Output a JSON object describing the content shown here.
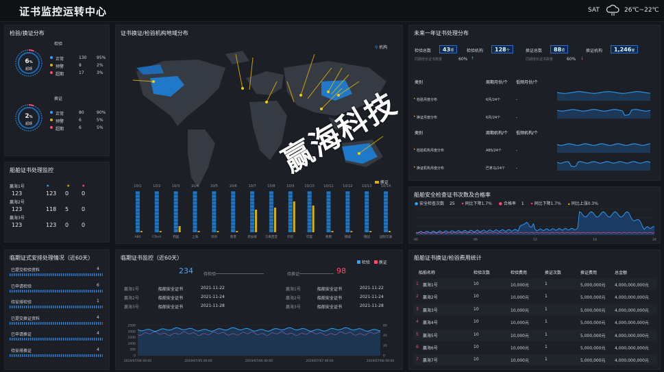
{
  "header": {
    "title": "证书监控运转中心",
    "day": "SAT",
    "temp": "26℃~22℃"
  },
  "insp": {
    "title": "检验/换证分布",
    "g1": {
      "label": "检验",
      "pct": "6",
      "unit": "%",
      "sub": "超期",
      "rows": [
        {
          "n": "正常",
          "c": "130",
          "p": "95%",
          "col": "#2aa4ff"
        },
        {
          "n": "预警",
          "c": "8",
          "p": "2%",
          "col": "#e0b000"
        },
        {
          "n": "超期",
          "c": "17",
          "p": "3%",
          "col": "#ff4d6d"
        }
      ]
    },
    "g2": {
      "label": "换证",
      "pct": "2",
      "unit": "%",
      "sub": "超期",
      "rows": [
        {
          "n": "正常",
          "c": "80",
          "p": "90%",
          "col": "#2aa4ff"
        },
        {
          "n": "预警",
          "c": "6",
          "p": "5%",
          "col": "#e0b000"
        },
        {
          "n": "超期",
          "c": "6",
          "p": "5%",
          "col": "#ff4d6d"
        }
      ]
    }
  },
  "ship": {
    "title": "船舶证书处理监控",
    "rows": [
      {
        "n": "赢海1号",
        "a": "123",
        "b": "123",
        "c": "0",
        "d": "0"
      },
      {
        "n": "赢海2号",
        "a": "123",
        "b": "118",
        "c": "5",
        "d": "0"
      },
      {
        "n": "赢海3号",
        "a": "123",
        "b": "123",
        "c": "0",
        "d": "0"
      }
    ]
  },
  "expire": {
    "title": "临期证式安排处理情况（近60天）",
    "rows": [
      {
        "n": "已提交检验资料",
        "v": "4"
      },
      {
        "n": "已申请检验",
        "v": "6"
      },
      {
        "n": "待安排检验",
        "v": "1"
      },
      {
        "n": "已提交换证资料",
        "v": "4"
      },
      {
        "n": "已申请换证",
        "v": "4"
      },
      {
        "n": "待安排换证",
        "v": "4"
      }
    ]
  },
  "map": {
    "title": "证书换证/检验机构地域分布",
    "legend": "机构",
    "legend2": "换证",
    "months": [
      "10/1",
      "10/2",
      "10/3",
      "10/4",
      "10/5",
      "10/6",
      "10/7",
      "10/8",
      "10/9",
      "10/10",
      "10/11",
      "10/12",
      "10/13",
      "10/14"
    ],
    "xlabels": [
      "ABS",
      "CTech",
      "韩国",
      "上海",
      "深圳",
      "香港",
      "新加坡",
      "马来西亚",
      "印尼",
      "印度",
      "希腊",
      "挪威",
      "德国",
      "国际交通"
    ],
    "chart_data": {
      "type": "bar",
      "categories": [
        "ABS",
        "CTech",
        "韩国",
        "上海",
        "深圳",
        "香港",
        "新加坡",
        "马来西亚",
        "印尼",
        "印度",
        "希腊",
        "挪威",
        "德国",
        "国际交通"
      ],
      "series": [
        {
          "values": [
            100,
            100,
            100,
            100,
            100,
            100,
            100,
            100,
            100,
            100,
            100,
            100,
            100,
            100
          ]
        },
        {
          "name": "换证",
          "values": [
            3,
            3,
            15,
            3,
            3,
            3,
            55,
            60,
            75,
            65,
            3,
            3,
            3,
            3
          ]
        }
      ],
      "ylim": [
        0,
        100
      ]
    }
  },
  "year": {
    "title": "未来一年证书处理分布",
    "kpis": [
      {
        "n": "检验总数",
        "v": "43",
        "u": "项"
      },
      {
        "n": "检验机构",
        "v": "128",
        "u": "个"
      },
      {
        "n": "换证总数",
        "v": "88",
        "u": "项"
      },
      {
        "n": "换证机构",
        "v": "1,246",
        "u": "家"
      }
    ],
    "sub1": "同期增长证书数量",
    "sub1v": "60%",
    "sub2": "同期增长证书数量",
    "sub2v": "60%",
    "h1": [
      "类别",
      "周期月份/个",
      "低频月份/个"
    ],
    "r1": [
      {
        "n": "检验月度分布",
        "a": "6月/24个",
        "b": "-"
      },
      {
        "n": "换证月度分布",
        "a": "6月/24个",
        "b": "-"
      }
    ],
    "h2": [
      "类别",
      "周期机构/个",
      "低频机构/个"
    ],
    "r2": [
      {
        "n": "检验机构月度分布",
        "a": "ABS/24个",
        "b": "-"
      },
      {
        "n": "换证机构月度分布",
        "a": "巴拿马/24个",
        "b": "-"
      }
    ]
  },
  "rate": {
    "title": "船舶安全检查证书次数及合格率",
    "l1": "安全检查次数",
    "l1v": "25",
    "l2": "同比下降1.7%",
    "l3": "合格率",
    "l3v": "1",
    "l4": "同比下降1.7%",
    "l5": "同比上涨0.3%",
    "xt": [
      "00",
      "06",
      "12",
      "18",
      "24"
    ]
  },
  "mon": {
    "title": "临期证书监控（近60天）",
    "lg1": "检验",
    "lg2": "换证",
    "left": {
      "label": "待检验",
      "v": "234"
    },
    "right": {
      "label": "待换证",
      "v": "98"
    },
    "rowsL": [
      {
        "a": "赢海1号",
        "b": "船舶安全证书",
        "c": "2021-11-22"
      },
      {
        "a": "赢海2号",
        "b": "船舶安全证书",
        "c": "2021-11-24"
      },
      {
        "a": "赢海3号",
        "b": "船舶安全证书",
        "c": "2021-11-28"
      }
    ],
    "rowsR": [
      {
        "a": "赢海1号",
        "b": "船舶安全证书",
        "c": "2021-11-22"
      },
      {
        "a": "赢海2号",
        "b": "船舶安全证书",
        "c": "2021-11-24"
      },
      {
        "a": "赢海3号",
        "b": "船舶安全证书",
        "c": "2021-11-28"
      }
    ],
    "yl": [
      "2500",
      "2000",
      "1500",
      "1000",
      "500",
      "0"
    ],
    "yr": [
      "60",
      "40",
      "20",
      "0"
    ],
    "xt": [
      "2019/07/04 00:00",
      "2019/07/05 00:00",
      "2019/07/06 00:00",
      "2019/07/07 00:00",
      "2019/07/08 00:00"
    ]
  },
  "fee": {
    "title": "船舶证书换证/检验费用统计",
    "headers": [
      "船舶名称",
      "检验次数",
      "检验费用",
      "换证次数",
      "换证费用",
      "总金额"
    ],
    "rows": [
      {
        "i": "1",
        "n": "赢海1号",
        "a": "10",
        "b": "10,000元",
        "c": "1",
        "d": "5,000,000元",
        "e": "4,000,000,000元"
      },
      {
        "i": "2",
        "n": "赢海2号",
        "a": "10",
        "b": "10,000元",
        "c": "1",
        "d": "5,000,000元",
        "e": "4,000,000,000元"
      },
      {
        "i": "3",
        "n": "赢海3号",
        "a": "10",
        "b": "10,000元",
        "c": "1",
        "d": "5,000,000元",
        "e": "4,000,000,000元"
      },
      {
        "i": "4",
        "n": "赢海4号",
        "a": "10",
        "b": "10,000元",
        "c": "1",
        "d": "5,000,000元",
        "e": "4,000,000,000元"
      },
      {
        "i": "5",
        "n": "赢海5号",
        "a": "10",
        "b": "10,000元",
        "c": "1",
        "d": "5,000,000元",
        "e": "4,000,000,000元"
      },
      {
        "i": "6",
        "n": "赢海6号",
        "a": "10",
        "b": "10,000元",
        "c": "1",
        "d": "5,000,000元",
        "e": "4,000,000,000元"
      },
      {
        "i": "7",
        "n": "赢海7号",
        "a": "10",
        "b": "10,000元",
        "c": "1",
        "d": "5,000,000元",
        "e": "4,000,000,000元"
      }
    ]
  },
  "watermark": "赢海科技"
}
